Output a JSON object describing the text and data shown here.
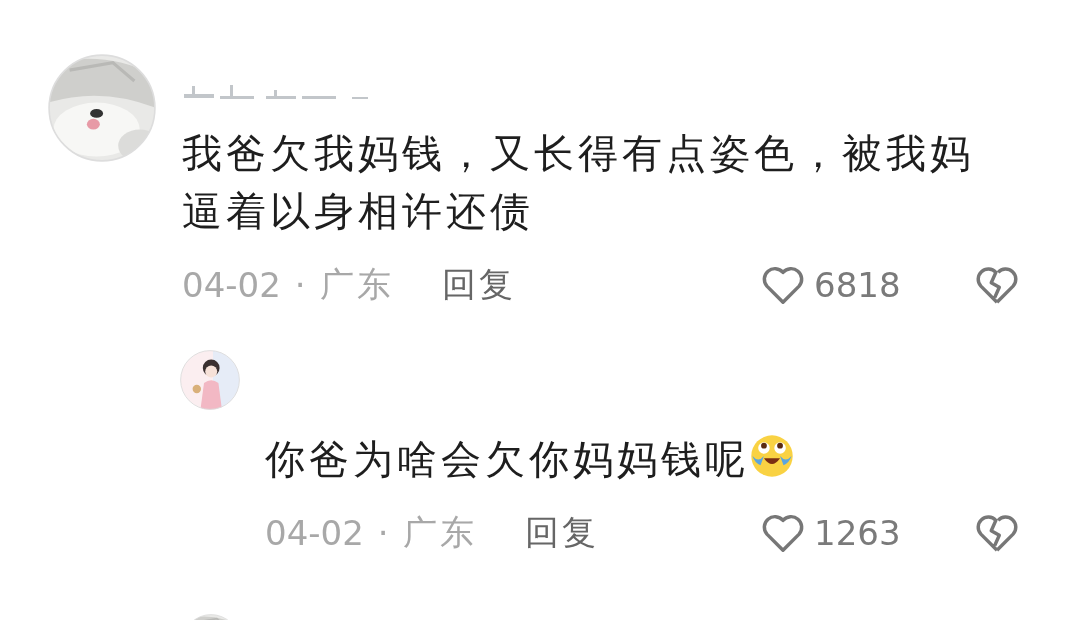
{
  "comments": [
    {
      "kind": "comment",
      "text": "我爸欠我妈钱，又长得有点姿色，被我妈逼着以身相许还债",
      "date": "04-02",
      "separator": "·",
      "location": "广东",
      "reply_label": "回复",
      "likes": "6818",
      "liked": false,
      "disliked": false
    },
    {
      "kind": "reply",
      "text": "你爸为啥会欠你妈妈钱呢",
      "emoji": {
        "kind": "laughing-crying"
      },
      "date": "04-02",
      "separator": "·",
      "location": "广东",
      "reply_label": "回复",
      "likes": "1263",
      "liked": false,
      "disliked": false
    },
    {
      "kind": "cut"
    }
  ]
}
